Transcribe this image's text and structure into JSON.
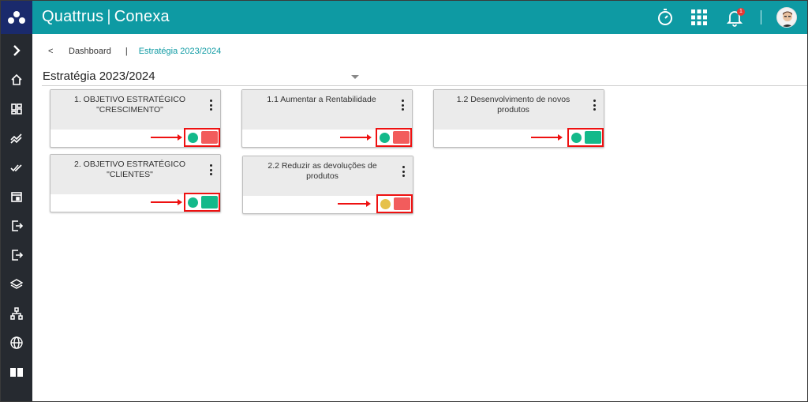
{
  "app": {
    "brand_left": "Quattrus",
    "brand_sep": "|",
    "brand_right": "Conexa",
    "notification_count": "1"
  },
  "sidebar": {
    "items": [
      {
        "icon": "chevron-right-icon"
      },
      {
        "icon": "home-icon"
      },
      {
        "icon": "dashboard-icon"
      },
      {
        "icon": "trend-icon"
      },
      {
        "icon": "double-check-icon"
      },
      {
        "icon": "calendar-icon"
      },
      {
        "icon": "logout-icon"
      },
      {
        "icon": "exit-icon"
      },
      {
        "icon": "layers-icon"
      },
      {
        "icon": "hierarchy-icon"
      },
      {
        "icon": "globe-icon"
      },
      {
        "icon": "book-icon"
      }
    ]
  },
  "breadcrumb": {
    "back": "<",
    "parent": "Dashboard",
    "sep": "|",
    "current": "Estratégia 2023/2024"
  },
  "page": {
    "title": "Estratégia 2023/2024"
  },
  "cards": [
    {
      "title": "1. OBJETIVO ESTRATÉGICO \"CRESCIMENTO\"",
      "dot_color": "#13b98a",
      "rect_color": "#f25c5c"
    },
    {
      "title": "1.1 Aumentar a Rentabilidade",
      "dot_color": "#13b98a",
      "rect_color": "#f25c5c"
    },
    {
      "title": "1.2 Desenvolvimento de novos produtos",
      "dot_color": "#13b98a",
      "rect_color": "#13b98a"
    },
    {
      "title": "2. OBJETIVO ESTRATÉGICO \"CLIENTES\"",
      "dot_color": "#13b98a",
      "rect_color": "#13b98a"
    },
    {
      "title": "2.2 Reduzir as devoluções de produtos",
      "dot_color": "#e6c14a",
      "rect_color": "#f25c5c"
    }
  ],
  "colors": {
    "topbar": "#0e9aa3",
    "sidebar": "#262a30",
    "brand_corner": "#1a2a6c",
    "highlight": "#e11111"
  }
}
